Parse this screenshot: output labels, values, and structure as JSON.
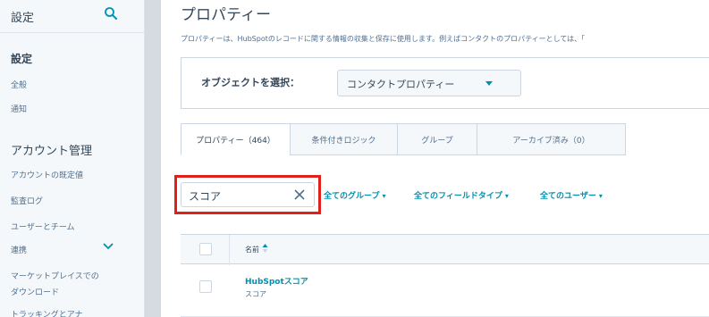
{
  "sidebar": {
    "header": "設定",
    "section1": "設定",
    "items1": [
      "全般",
      "通知"
    ],
    "section2": "アカウント管理",
    "items2": [
      "アカウントの既定値",
      "監査ログ",
      "ユーザーとチーム",
      "連携",
      "マーケットプレイスでの",
      "ダウンロード",
      "トラッキングとアナ"
    ]
  },
  "main": {
    "title": "プロパティー",
    "description": "プロパティーは、HubSpotのレコードに関する情報の収集と保存に使用します。例えばコンタクトのプロパティーとしては、「",
    "object_label": "オブジェクトを選択：",
    "object_select": "コンタクトプロパティー",
    "tabs": [
      "プロパティー（464）",
      "条件付きロジック",
      "グループ",
      "アーカイブ済み（0）"
    ],
    "search_value": "スコア",
    "filters": [
      "全てのグループ",
      "全てのフィールドタイプ",
      "全てのユーザー"
    ],
    "table": {
      "column_name": "名前",
      "rows": [
        {
          "name": "HubSpotスコア",
          "sub": "スコア"
        }
      ]
    }
  },
  "colors": {
    "accent": "#0091ae",
    "highlight": "#e0201a",
    "sidebar_bg": "#f5f8fa"
  }
}
